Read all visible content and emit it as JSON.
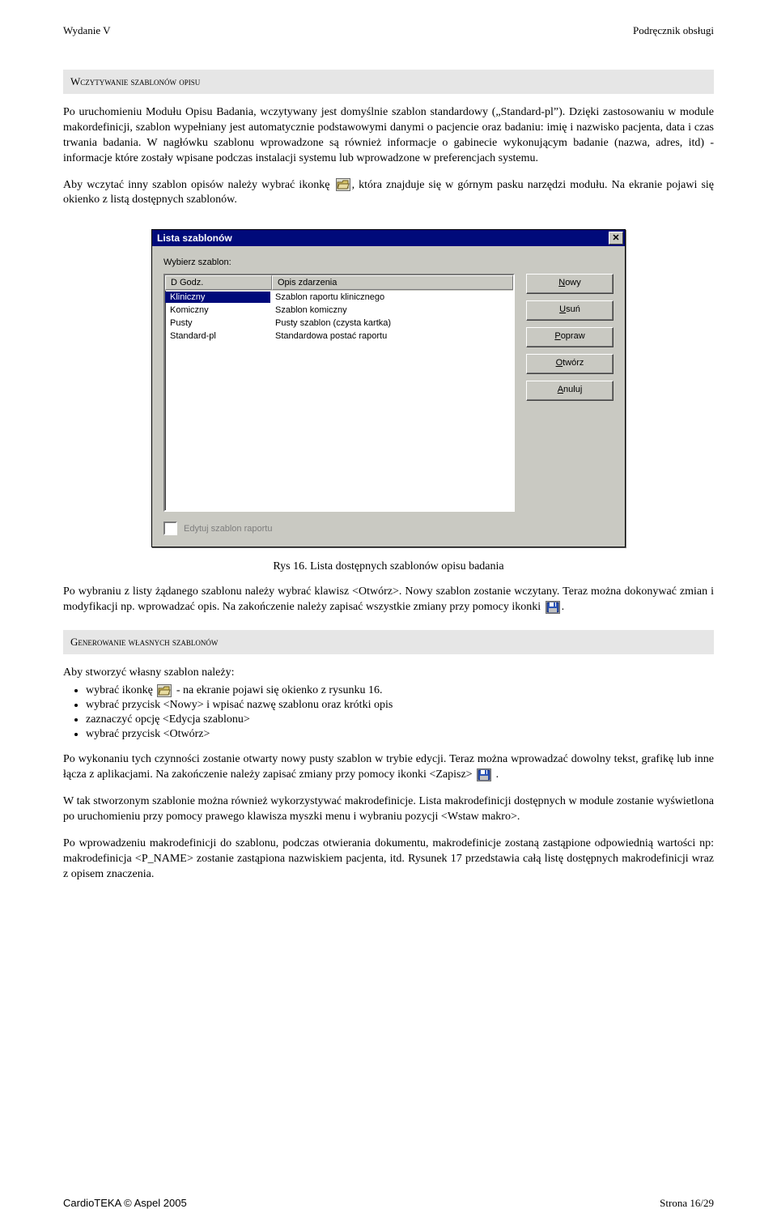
{
  "header": {
    "left": "Wydanie V",
    "right": "Podręcznik obsługi"
  },
  "section1": {
    "title": "Wczytywanie szablonów opisu"
  },
  "p1": "Po uruchomieniu Modułu Opisu Badania, wczytywany jest domyślnie szablon standardowy („Standard-pl”). Dzięki zastosowaniu w module makordefinicji, szablon wypełniany jest automatycznie podstawowymi danymi o pacjencie oraz badaniu: imię i nazwisko pacjenta, data i czas trwania badania. W nagłówku szablonu wprowadzone są również informacje o gabinecie wykonującym badanie (nazwa, adres, itd) - informacje które zostały wpisane podczas instalacji systemu lub wprowadzone w preferencjach systemu.",
  "p2a": "Aby wczytać inny szablon opisów należy wybrać ikonkę ",
  "p2b": ", która znajduje  się w górnym pasku narzędzi modułu. Na ekranie pojawi się okienko z listą dostępnych szablonów.",
  "dialog": {
    "title": "Lista szablonów",
    "prompt": "Wybierz szablon:",
    "cols": {
      "c1": "D   Godz.",
      "c2": "Opis zdarzenia"
    },
    "rows": [
      {
        "c1": "Kliniczny",
        "c2": "Szablon raportu klinicznego",
        "sel": true
      },
      {
        "c1": "Komiczny",
        "c2": "Szablon komiczny"
      },
      {
        "c1": "Pusty",
        "c2": "Pusty szablon (czysta kartka)"
      },
      {
        "c1": "Standard-pl",
        "c2": "Standardowa postać raportu"
      }
    ],
    "buttons": {
      "new": "Nowy",
      "del": "Usuń",
      "edit": "Popraw",
      "open": "Otwórz",
      "cancel": "Anuluj"
    },
    "checkbox": "Edytuj szablon raportu"
  },
  "figcaption": "Rys 16. Lista dostępnych szablonów opisu badania",
  "p3": "Po wybraniu z listy żądanego szablonu należy wybrać klawisz <Otwórz>. Nowy szablon zostanie wczytany. Teraz można dokonywać zmian i modyfikacji np. wprowadzać opis. Na zakończenie należy zapisać wszystkie zmiany przy pomocy ikonki",
  "section2": {
    "title": "Generowanie własnych szablonów"
  },
  "p4": "Aby stworzyć własny szablon należy:",
  "list": {
    "i1a": "wybrać ikonkę ",
    "i1b": " - na ekranie pojawi się okienko z rysunku 16.",
    "i2": "wybrać przycisk <Nowy> i wpisać nazwę szablonu oraz krótki opis",
    "i3": "zaznaczyć opcję <Edycja szablonu>",
    "i4": "wybrać przycisk <Otwórz>"
  },
  "p5a": "Po wykonaniu tych czynności zostanie otwarty nowy pusty szablon w trybie edycji. Teraz można wprowadzać dowolny tekst, grafikę lub inne łącza z aplikacjami. Na zakończenie należy zapisać zmiany przy pomocy ikonki <Zapisz> ",
  "p5b": " .",
  "p6": "W tak stworzonym szablonie można również wykorzystywać makrodefinicje. Lista makrodefinicji dostępnych w module zostanie wyświetlona po uruchomieniu przy pomocy prawego klawisza myszki menu i wybraniu pozycji <Wstaw makro>.",
  "p7": "Po wprowadzeniu makrodefinicji do szablonu, podczas otwierania dokumentu, makrodefinicje zostaną zastąpione odpowiednią wartości np: makrodefinicja <P_NAME> zostanie zastąpiona nazwiskiem pacjenta, itd. Rysunek 17 przedstawia całą listę dostępnych makrodefinicji wraz z opisem znaczenia.",
  "footer": {
    "left": "CardioTEKA © Aspel 2005",
    "right_label": "Strona ",
    "page": "16/29"
  }
}
